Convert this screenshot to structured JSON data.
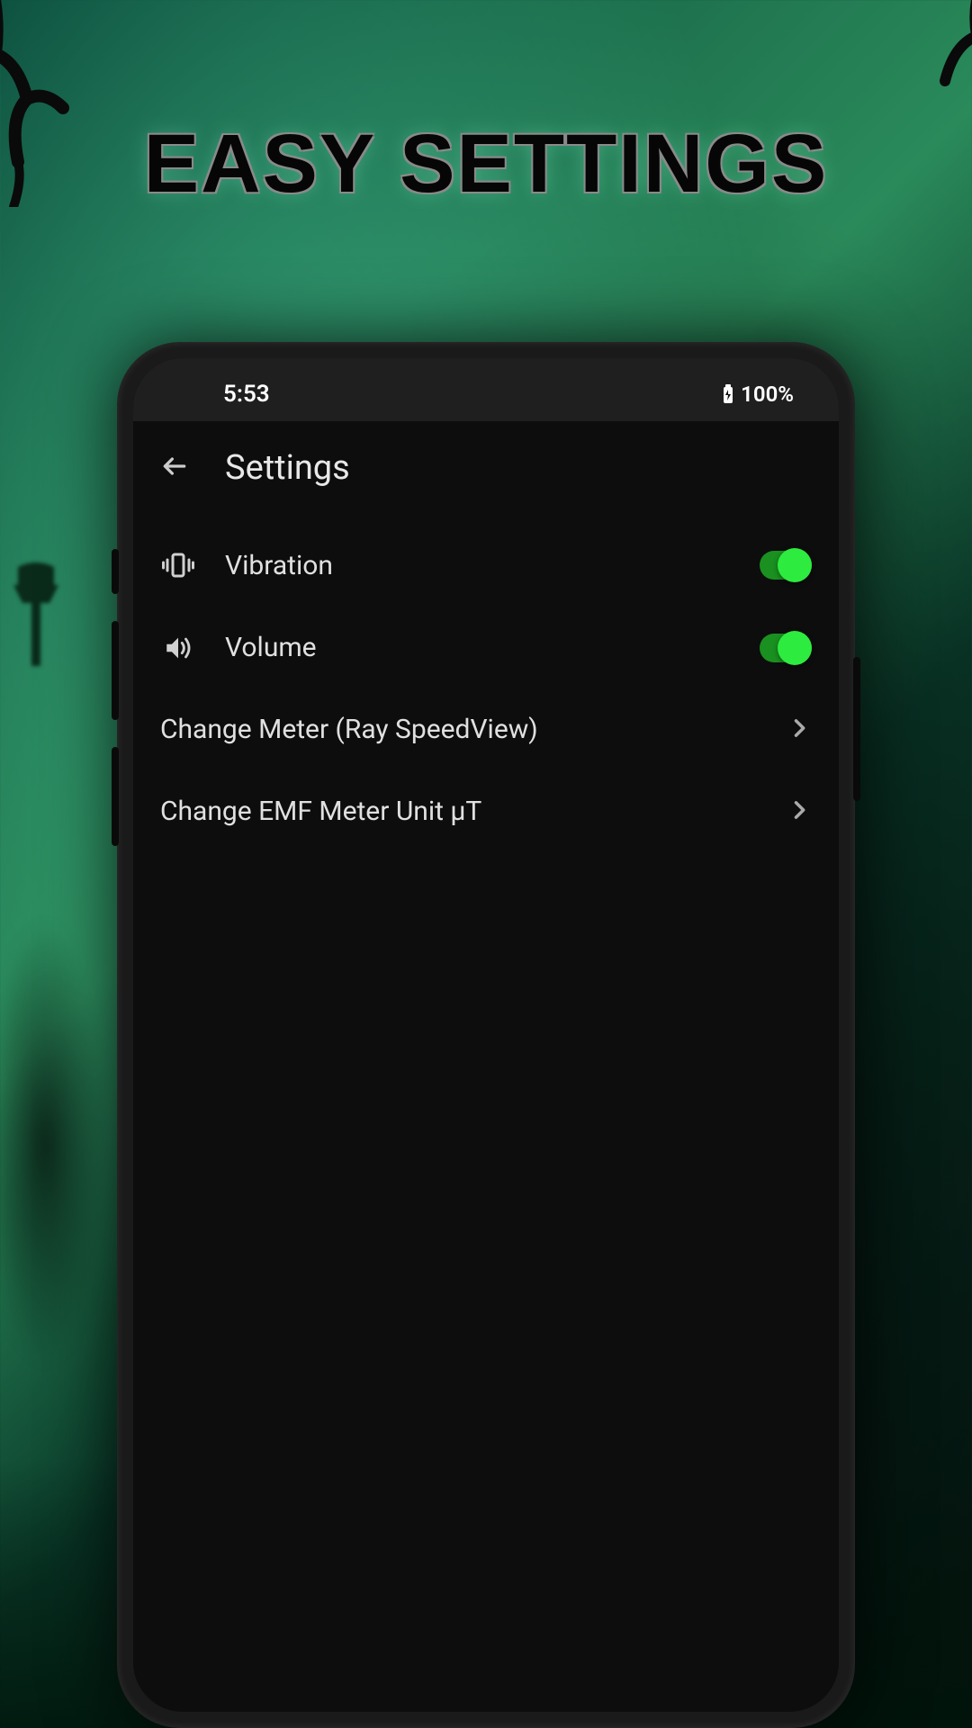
{
  "promo": {
    "title": "EASY SETTINGS"
  },
  "status_bar": {
    "time": "5:53",
    "battery": "100%"
  },
  "header": {
    "title": "Settings"
  },
  "settings": {
    "vibration": {
      "label": "Vibration",
      "enabled": true
    },
    "volume": {
      "label": "Volume",
      "enabled": true
    },
    "change_meter": {
      "label": "Change Meter (Ray SpeedView)"
    },
    "change_emf_unit": {
      "label": "Change EMF Meter Unit µT"
    }
  },
  "colors": {
    "accent_green": "#2eeb3f",
    "toggle_track": "#1a9020",
    "background": "#0d0d0d",
    "text": "#e0e0e0"
  }
}
